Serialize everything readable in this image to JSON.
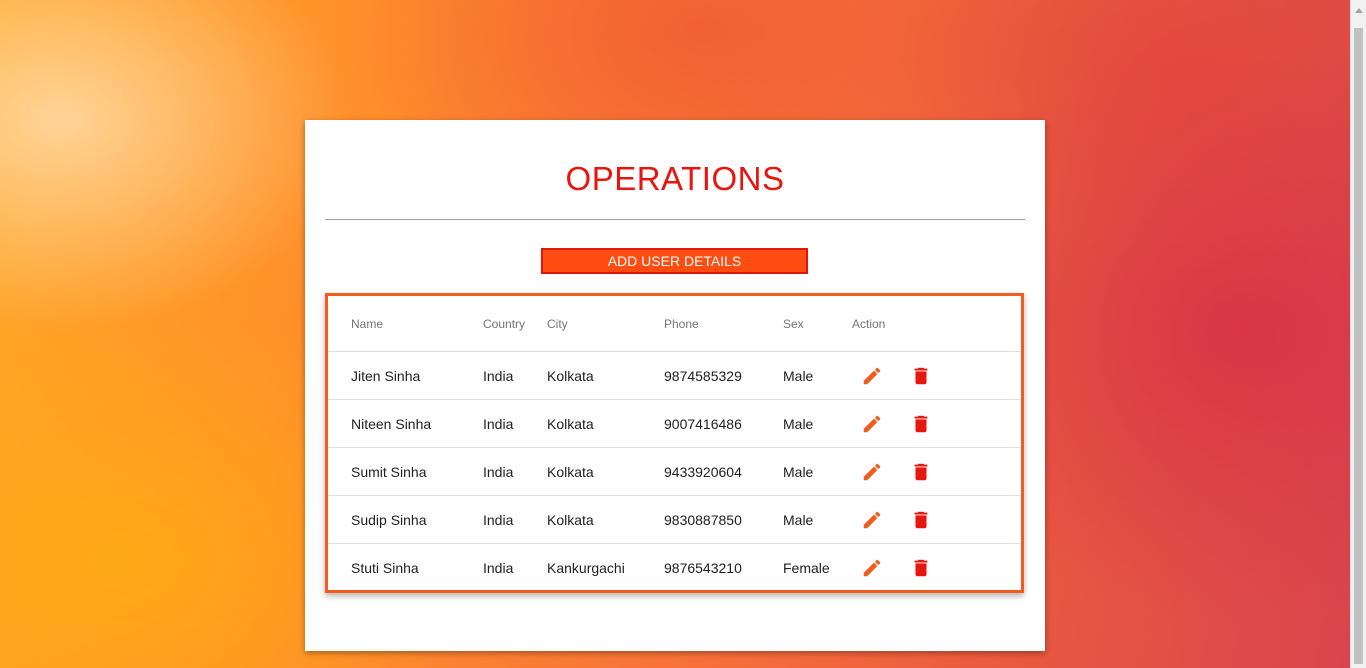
{
  "page": {
    "title": "OPERATIONS",
    "add_button_label": "ADD USER DETAILS"
  },
  "table": {
    "headers": {
      "name": "Name",
      "country": "Country",
      "city": "City",
      "phone": "Phone",
      "sex": "Sex",
      "action": "Action"
    },
    "rows": [
      {
        "name": "Jiten Sinha",
        "country": "India",
        "city": "Kolkata",
        "phone": "9874585329",
        "sex": "Male"
      },
      {
        "name": "Niteen Sinha",
        "country": "India",
        "city": "Kolkata",
        "phone": "9007416486",
        "sex": "Male"
      },
      {
        "name": "Sumit Sinha",
        "country": "India",
        "city": "Kolkata",
        "phone": "9433920604",
        "sex": "Male"
      },
      {
        "name": "Sudip Sinha",
        "country": "India",
        "city": "Kolkata",
        "phone": "9830887850",
        "sex": "Male"
      },
      {
        "name": "Stuti Sinha",
        "country": "India",
        "city": "Kankurgachi",
        "phone": "9876543210",
        "sex": "Female"
      }
    ],
    "edit_icon": "pencil-icon",
    "delete_icon": "trash-icon"
  },
  "colors": {
    "title": "#e8150f",
    "button_bg": "#ff4d12",
    "table_border": "#f25c1d",
    "edit_icon": "#f25c1d",
    "delete_icon": "#e8150f"
  }
}
